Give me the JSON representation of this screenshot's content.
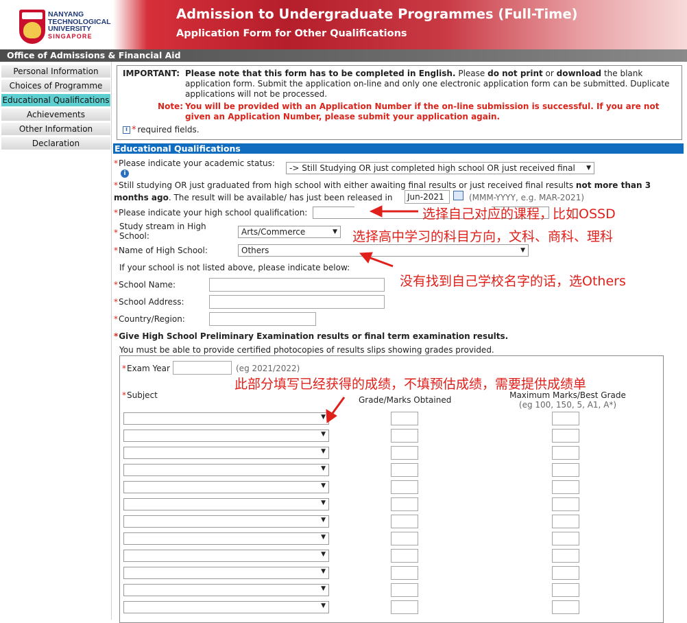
{
  "header": {
    "logo_lines": [
      "NANYANG",
      "TECHNOLOGICAL",
      "UNIVERSITY"
    ],
    "logo_country": "SINGAPORE",
    "title": "Admission to Undergraduate Programmes (Full-Time)",
    "subtitle": "Application Form for Other Qualifications",
    "office": "Office of Admissions & Financial Aid"
  },
  "sidebar": {
    "items": [
      {
        "label": "Personal Information",
        "active": false
      },
      {
        "label": "Choices of Programme",
        "active": false
      },
      {
        "label": "Educational Qualifications",
        "active": true
      },
      {
        "label": "Achievements",
        "active": false
      },
      {
        "label": "Other Information",
        "active": false
      },
      {
        "label": "Declaration",
        "active": false
      }
    ]
  },
  "important": {
    "label": "IMPORTANT:",
    "text_bold1": "Please note that this form has to be completed in English.",
    "text_mid1": " Please ",
    "text_bold2": "do not print",
    "text_mid2": " or ",
    "text_bold3": "download",
    "text_rest": " the blank application form. Submit the application on-line and only one electronic application form can be submitted. Duplicate applications will not be processed.",
    "note_label": "Note:",
    "note_text": "You will be provided with an Application Number if the on-line submission is successful. If you are not given an Application Number, please submit your application again.",
    "required_text": "required fields."
  },
  "section": {
    "title": "Educational Qualifications"
  },
  "form": {
    "academic_status_label": "Please indicate your academic status:",
    "academic_status_value": "-> Still Studying OR just completed high school OR just received final",
    "still_studying_text": "Still studying OR just graduated from high school with either awaiting final results or just received final results ",
    "still_studying_bold": "not more than 3 months ago",
    "still_studying_rest": ". The result will be available/ has just been released in",
    "release_value": "Jun-2021",
    "release_hint": "(MMM-YYYY, e.g. MAR-2021)",
    "qualification_label": "Please indicate your high school qualification:",
    "qualification_value": "",
    "stream_label": "Study stream in High School:",
    "stream_value": "Arts/Commerce",
    "school_label": "Name of High School:",
    "school_value": "Others",
    "not_listed_text": "If your school is not listed above, please indicate below:",
    "school_name_label": "School Name:",
    "school_address_label": "School Address:",
    "country_label": "Country/Region:",
    "results_title": "Give High School Preliminary Examination results or final term examination results.",
    "results_note": "You must be able to provide certified photocopies of results slips showing grades provided.",
    "exam_year_label": "Exam Year",
    "exam_year_hint": "(eg 2021/2022)",
    "subject_label": "Subject",
    "grade_label": "Grade/Marks Obtained",
    "max_label": "Maximum Marks/Best Grade",
    "max_hint": "(eg 100, 150, 5, A1, A*)",
    "subject_rows": 12
  },
  "annotations": {
    "a1": "选择自己对应的课程，比如OSSD",
    "a2": "选择高中学习的科目方向，文科、商科、理科",
    "a3": "没有找到自己学校名字的话，选Others",
    "a4": "此部分填写已经获得的成绩，不填预估成绩，需要提供成绩单"
  },
  "colors": {
    "accent_red": "#d9261c",
    "section_blue": "#0f6cbf",
    "active_nav": "#5dcfd0",
    "annotation_red": "#e0201b"
  }
}
